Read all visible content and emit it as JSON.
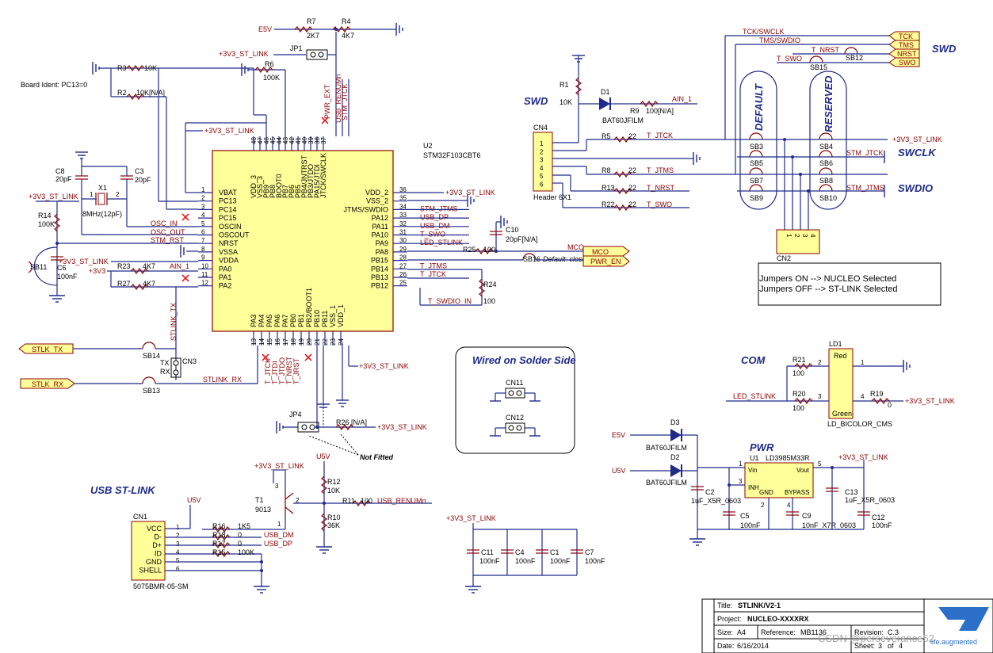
{
  "sections": {
    "swd_top": "SWD",
    "swd_left": "SWD",
    "usb": "USB ST-LINK",
    "com": "COM",
    "pwr": "PWR",
    "wired": "Wired on Solder Side",
    "not_fitted": "Not Fitted",
    "board_ident": "Board Ident: PC13=0",
    "swclk": "SWCLK",
    "swdio": "SWDIO",
    "default": "DEFAULT",
    "reserved": "RESERVED"
  },
  "u2": {
    "ref": "U2",
    "part": "STM32F103CBT6",
    "left_pins": [
      {
        "no": "1",
        "name": "VBAT"
      },
      {
        "no": "2",
        "name": "PC13"
      },
      {
        "no": "3",
        "name": "PC14"
      },
      {
        "no": "4",
        "name": "PC15"
      },
      {
        "no": "5",
        "name": "OSCIN"
      },
      {
        "no": "6",
        "name": "OSCOUT"
      },
      {
        "no": "7",
        "name": "NRST"
      },
      {
        "no": "8",
        "name": "VSSA"
      },
      {
        "no": "9",
        "name": "VDDA"
      },
      {
        "no": "10",
        "name": "PA0"
      },
      {
        "no": "11",
        "name": "PA1"
      },
      {
        "no": "12",
        "name": "PA2"
      }
    ],
    "right_pins": [
      {
        "no": "36",
        "name": "VDD_2",
        "net": "+3V3_ST_LINK"
      },
      {
        "no": "35",
        "name": "VSS_2",
        "net": ""
      },
      {
        "no": "34",
        "name": "JTMS/SWDIO",
        "net": "STM_JTMS"
      },
      {
        "no": "33",
        "name": "PA12",
        "net": "USB_DP"
      },
      {
        "no": "32",
        "name": "PA11",
        "net": "USB_DM"
      },
      {
        "no": "31",
        "name": "PA10",
        "net": "T_SWO"
      },
      {
        "no": "30",
        "name": "PA9",
        "net": "LED_STLINK"
      },
      {
        "no": "29",
        "name": "PA8",
        "net": ""
      },
      {
        "no": "28",
        "name": "PB15",
        "net": ""
      },
      {
        "no": "27",
        "name": "PB14",
        "net": "T_JTMS"
      },
      {
        "no": "26",
        "name": "PB13",
        "net": "T_JTCK"
      },
      {
        "no": "25",
        "name": "PB12",
        "net": ""
      }
    ],
    "top_pins": [
      {
        "no": "48",
        "name": "VDD_3"
      },
      {
        "no": "47",
        "name": "VSS_3"
      },
      {
        "no": "46",
        "name": "PB9"
      },
      {
        "no": "45",
        "name": "PB8"
      },
      {
        "no": "44",
        "name": "BOOT0"
      },
      {
        "no": "43",
        "name": "PB7"
      },
      {
        "no": "42",
        "name": "PB6"
      },
      {
        "no": "41",
        "name": "PB5"
      },
      {
        "no": "40",
        "name": "PB4/JNTRST"
      },
      {
        "no": "39",
        "name": "PB3/JTDO"
      },
      {
        "no": "38",
        "name": "PA15/JTDI"
      },
      {
        "no": "37",
        "name": "JTCK/SWCLK"
      }
    ],
    "bottom_pins": [
      {
        "no": "13",
        "name": "PA3"
      },
      {
        "no": "14",
        "name": "PA4"
      },
      {
        "no": "15",
        "name": "PA5"
      },
      {
        "no": "16",
        "name": "PA6"
      },
      {
        "no": "17",
        "name": "PA7"
      },
      {
        "no": "18",
        "name": "PB0"
      },
      {
        "no": "19",
        "name": "PB1"
      },
      {
        "no": "20",
        "name": "PB2/BOOT1"
      },
      {
        "no": "21",
        "name": "PB10"
      },
      {
        "no": "22",
        "name": "PB11"
      },
      {
        "no": "23",
        "name": "VSS_1"
      },
      {
        "no": "24",
        "name": "VDD_1"
      }
    ],
    "top_nets": [
      "PWR_EXT",
      "USB_RENUMn",
      "STM_JTCK"
    ],
    "bottom_nets": [
      "T_JTCK",
      "T_JTDI",
      "T_JTDO",
      "T_NRST",
      "T_JRST"
    ]
  },
  "parts": {
    "r7": "R7",
    "r7v": "2K7",
    "r4": "R4",
    "r4v": "4K7",
    "jp1": "JP1",
    "r6": "R6",
    "r6v": "100K",
    "r3": "R3",
    "r3v": "10K",
    "r2": "R2",
    "r2v": "10K[N/A]",
    "c8": "C8",
    "c8v": "20pF",
    "c3": "C3",
    "c3v": "20pF",
    "x1": "X1",
    "x1v": "8MHz(12pF)",
    "r14": "R14",
    "r14v": "100K",
    "c6": "C6",
    "c6v": "100nF",
    "sb11": "SB11",
    "r23": "R23",
    "r23v": "4K7",
    "r27": "R27",
    "r27v": "4K7",
    "c10": "C10",
    "c10v": "20pF[N/A]",
    "r25": "R25",
    "r25v": "100",
    "sb16": "SB16",
    "sb16note": "Default: closed",
    "r24": "R24",
    "r24v": "100",
    "sb14": "SB14",
    "sb13": "SB13",
    "cn3": "CN3",
    "tx": "TX",
    "rx": "RX",
    "jp4": "JP4",
    "r26": "R26",
    "r26v": "[N/A]",
    "r1": "R1",
    "r1v": "10K",
    "d1": "D1",
    "d1v": "BAT60JFILM",
    "r9": "R9",
    "r9v": "100[N/A]",
    "cn4": "CN4",
    "cn4v": "Header 6X1",
    "cn4pins": [
      "1",
      "2",
      "3",
      "4",
      "5",
      "6"
    ],
    "r5": "R5",
    "r5v": "22",
    "r8": "R8",
    "r8v": "22",
    "r13": "R13",
    "r13v": "22",
    "r22": "R22",
    "r22v": "22",
    "sb3": "SB3",
    "sb4": "SB4",
    "sb5": "SB5",
    "sb6": "SB6",
    "sb7": "SB7",
    "sb8": "SB8",
    "sb9": "SB9",
    "sb10": "SB10",
    "sb12": "SB12",
    "sb15": "SB15",
    "cn2": "CN2",
    "cn2pins": [
      "1",
      "2",
      "3",
      "4"
    ],
    "cn11": "CN11",
    "cn12": "CN12",
    "ld1": "LD1",
    "ld1v": "LD_BICOLOR_CMS",
    "ld1red": "Red",
    "ld1green": "Green",
    "r21": "R21",
    "r21v": "100",
    "r20": "R20",
    "r20v": "100",
    "r19": "R19",
    "r19v": "0",
    "d3": "D3",
    "d3v": "BAT60JFILM",
    "d2": "D2",
    "d2v": "BAT60JFILM",
    "u1": "U1",
    "u1v": "LD3985M33R",
    "u1vin": "Vin",
    "u1vout": "Vout",
    "u1inh": "INH",
    "u1gnd": "GND",
    "u1byp": "BYPASS",
    "c2": "C2",
    "c2v": "1uF_X5R_0603",
    "c13": "C13",
    "c13v": "1uF_X5R_0603",
    "c5": "C5",
    "c5v": "100nF",
    "c9": "C9",
    "c9v": "10nF_X7R_0603",
    "c12": "C12",
    "c12v": "100nF",
    "t1": "T1",
    "t1v": "9013",
    "r12": "R12",
    "r12v": "10K",
    "r10": "R10",
    "r10v": "36K",
    "r11": "R11",
    "r11v": "100",
    "cn1": "CN1",
    "cn1v": "5075BMR-05-SM",
    "cn1pins": [
      "VCC",
      "D-",
      "D+",
      "ID",
      "GND",
      "SHELL"
    ],
    "r16": "R16",
    "r16v": "1K5",
    "r18": "R18",
    "r18v": "0",
    "r17": "R17",
    "r17v": "0",
    "r15": "R15",
    "r15v": "100K",
    "c11": "C11",
    "c11v": "100nF",
    "c4": "C4",
    "c4v": "100nF",
    "c1": "C1",
    "c1v": "100nF",
    "c7": "C7",
    "c7v": "100nF"
  },
  "nets": {
    "e5v": "E5V",
    "u5v": "U5V",
    "v33": "+3V3_ST_LINK",
    "v3": "+3V3",
    "osc_in": "OSC_IN",
    "osc_out": "OSC_OUT",
    "stm_rst": "STM_RST",
    "ain1": "AIN_1",
    "stlink_tx": "STLINK_TX",
    "stlink_rx": "STLINK_RX",
    "stlk_tx": "STLK_TX",
    "stlk_rx": "STLK_RX",
    "mco": "MCO",
    "pwr_en": "PWR_EN",
    "t_swdio_in": "T_SWDIO_IN",
    "t_jtck": "T_JTCK",
    "t_jtms": "T_JTMS",
    "t_nrst": "T_NRST",
    "t_swo": "T_SWO",
    "tck_swclk": "TCK/SWCLK",
    "tms_swdio": "TMS/SWDIO",
    "tck": "TCK",
    "tms": "TMS",
    "nrst": "NRST",
    "swo": "SWO",
    "stm_jtck": "STM_JTCK",
    "stm_jtms": "STM_JTMS",
    "led_stlink": "LED_STLINK",
    "usb_dm": "USB_DM",
    "usb_dp": "USB_DP",
    "usb_renumn": "USB_RENUMn"
  },
  "jumpers_note": [
    "Jumpers ON  --> NUCLEO Selected",
    "Jumpers OFF --> ST-LINK Selected"
  ],
  "title_block": {
    "title_label": "Title:",
    "title": "STLINK/V2-1",
    "project_label": "Project:",
    "project": "NUCLEO-XXXXRX",
    "size_label": "Size:",
    "size": "A4",
    "reference_label": "Reference:",
    "reference": "MB1136",
    "revision_label": "Revision:",
    "revision": "C.3",
    "date_label": "Date:",
    "date": "6/16/2014",
    "sheet_label": "Sheet:",
    "sheet": "3",
    "of_label": "of",
    "sheets": "4",
    "logo": "ST",
    "logo_tagline": "life.augmented",
    "watermark": "CSDN @perseverance52"
  },
  "colors": {
    "wire": "#1f2a8a",
    "component": "#8b0000",
    "chip_fill": "#ffff99",
    "no_connect": "#e00000",
    "logo": "#2b6fc9"
  }
}
